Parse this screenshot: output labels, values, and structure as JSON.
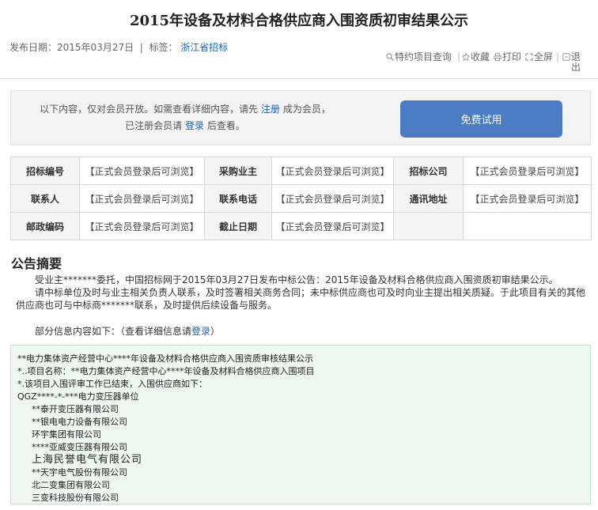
{
  "page_title": "2015年设备及材料合格供应商入围资质初审结果公示",
  "meta": {
    "publish_label": "发布日期：",
    "publish_date": "2015年03月27日",
    "sep": "|",
    "tag_label": "标签：",
    "tag_value": "浙江省招标"
  },
  "tools": {
    "query": "特约项目查询",
    "favorite": "收藏",
    "print": "打印",
    "fullscreen": "全屏",
    "exit1": "退",
    "exit2": "出"
  },
  "member": {
    "line1_pre": "以下内容，仅对会员开放。如需查看详细内容，请先",
    "register": "注册",
    "line1_post": "成为会员，",
    "line2_pre": "已注册会员请",
    "login": "登录",
    "line2_post": "后查看。",
    "trial_button": "免费试用"
  },
  "table": {
    "rows": [
      [
        {
          "label": "招标编号",
          "value": "【正式会员登录后可浏览】"
        },
        {
          "label": "采购业主",
          "value": "【正式会员登录后可浏览】"
        },
        {
          "label": "招标公司",
          "value": "【正式会员登录后可浏览】"
        }
      ],
      [
        {
          "label": "联系人",
          "value": "【正式会员登录后可浏览】"
        },
        {
          "label": "联系电话",
          "value": "【正式会员登录后可浏览】"
        },
        {
          "label": "通讯地址",
          "value": "【正式会员登录后可浏览】"
        }
      ],
      [
        {
          "label": "邮政编码",
          "value": "【正式会员登录后可浏览】"
        },
        {
          "label": "截止日期",
          "value": "【正式会员登录后可浏览】"
        }
      ]
    ]
  },
  "summary": {
    "title": "公告摘要",
    "para1": "受业主*******委托，中国招标网于2015年03月27日发布中标公告：2015年设备及材料合格供应商入围资质初审结果公示。",
    "para2": "请中标单位及时与业主相关负责人联系，及时签署相关商务合同；未中标供应商也可及时向业主提出相关质疑。于此项目有关的其他供应商也可与中标商*******联系，及时提供后续设备与服务。",
    "partial_pre": "部分信息内容如下：（查看详细信息请",
    "partial_link": "登录",
    "partial_post": "）"
  },
  "content": {
    "lines": [
      "**电力集体资产经营中心****年设备及材料合格供应商入围资质审核结果公示",
      "*..项目名称：**电力集体资产经营中心****年设备及材料合格供应商入围项目",
      "*.该项目入围评审工作已结束，入围供应商如下：",
      "QGZ****-*-***电力变压器单位"
    ],
    "companies": [
      "**泰开变压器有限公司",
      "**银电电力设备有限公司",
      "环宇集团有限公司",
      "****亚威变压器有限公司",
      "上海民誉电气有限公司",
      "**天宇电气股份有限公司",
      "北二变集团有限公司",
      "三变科技股份有限公司"
    ]
  }
}
